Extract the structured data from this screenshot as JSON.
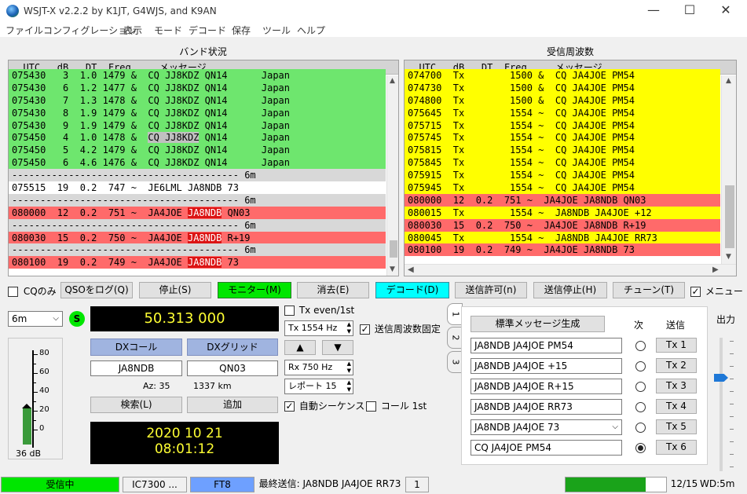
{
  "app": {
    "title": "WSJT-X   v2.2.2   by K1JT, G4WJS, and K9AN"
  },
  "menu": [
    "ファイル",
    "コンフィグレーション",
    "表示",
    "モード",
    "デコード",
    "保存",
    "ツール",
    "ヘルプ"
  ],
  "band_panel": {
    "title": "バンド状況",
    "header": "  UTC   dB   DT  Freq     メッセージ",
    "rows": [
      {
        "t": "075430   3  1.0 1479 &  CQ JJ8KDZ QN14      Japan",
        "c": "g"
      },
      {
        "t": "075430   6  1.2 1477 &  CQ JJ8KDZ QN14      Japan",
        "c": "g"
      },
      {
        "t": "075430   7  1.3 1478 &  CQ JJ8KDZ QN14      Japan",
        "c": "g"
      },
      {
        "t": "075430   8  1.9 1479 &  CQ JJ8KDZ QN14      Japan",
        "c": "g"
      },
      {
        "t": "075430   9  1.9 1479 &  CQ JJ8KDZ QN14      Japan",
        "c": "g"
      },
      {
        "t": "075450   4  1.0 1478 &  ",
        "c": "g",
        "h": "CQ JJ8KDZ",
        "hc": "gr",
        "a": " QN14      Japan"
      },
      {
        "t": "075450   5  4.2 1479 &  CQ JJ8KDZ QN14      Japan",
        "c": "g"
      },
      {
        "t": "075450   6  4.6 1476 &  CQ JJ8KDZ QN14      Japan",
        "c": "g"
      },
      {
        "t": "---------------------------------------- 6m",
        "c": "s"
      },
      {
        "t": "075515  19  0.2  747 ~  JE6LML JA8NDB 73",
        "c": "w"
      },
      {
        "t": "---------------------------------------- 6m",
        "c": "s"
      },
      {
        "t": "080000  12  0.2  751 ~  JA4JOE ",
        "c": "r",
        "h": "JA8NDB",
        "hc": "hl",
        "a": " QN03"
      },
      {
        "t": "---------------------------------------- 6m",
        "c": "s"
      },
      {
        "t": "080030  15  0.2  750 ~  JA4JOE ",
        "c": "r",
        "h": "JA8NDB",
        "hc": "hl",
        "a": " R+19"
      },
      {
        "t": "---------------------------------------- 6m",
        "c": "s"
      },
      {
        "t": "080100  19  0.2  749 ~  JA4JOE ",
        "c": "r",
        "h": "JA8NDB",
        "hc": "hl",
        "a": " 73"
      }
    ]
  },
  "rx_panel": {
    "title": "受信周波数",
    "header": "  UTC   dB   DT  Freq     メッセージ",
    "rows": [
      {
        "t": "074700  Tx        1500 &  CQ JA4JOE PM54",
        "c": "y"
      },
      {
        "t": "074730  Tx        1500 &  CQ JA4JOE PM54",
        "c": "y"
      },
      {
        "t": "074800  Tx        1500 &  CQ JA4JOE PM54",
        "c": "y"
      },
      {
        "t": "075645  Tx        1554 ~  CQ JA4JOE PM54",
        "c": "y"
      },
      {
        "t": "075715  Tx        1554 ~  CQ JA4JOE PM54",
        "c": "y"
      },
      {
        "t": "075745  Tx        1554 ~  CQ JA4JOE PM54",
        "c": "y"
      },
      {
        "t": "075815  Tx        1554 ~  CQ JA4JOE PM54",
        "c": "y"
      },
      {
        "t": "075845  Tx        1554 ~  CQ JA4JOE PM54",
        "c": "y"
      },
      {
        "t": "075915  Tx        1554 ~  CQ JA4JOE PM54",
        "c": "y"
      },
      {
        "t": "075945  Tx        1554 ~  CQ JA4JOE PM54",
        "c": "y"
      },
      {
        "t": "080000  12  0.2  751 ~  JA4JOE JA8NDB QN03",
        "c": "r"
      },
      {
        "t": "080015  Tx        1554 ~  JA8NDB JA4JOE +12",
        "c": "y"
      },
      {
        "t": "080030  15  0.2  750 ~  JA4JOE JA8NDB R+19",
        "c": "r"
      },
      {
        "t": "080045  Tx        1554 ~  JA8NDB JA4JOE RR73",
        "c": "y"
      },
      {
        "t": "080100  19  0.2  749 ~  JA4JOE JA8NDB 73",
        "c": "r"
      }
    ]
  },
  "controls": {
    "cq_only": "CQのみ",
    "log_qso": "QSOをログ(Q)",
    "stop": "停止(S)",
    "monitor": "モニター(M)",
    "erase": "消去(E)",
    "decode": "デコード(D)",
    "enable_tx": "送信許可(n)",
    "halt_tx": "送信停止(H)",
    "tune": "チューン(T)",
    "menus": "メニュー"
  },
  "left": {
    "band": "6m",
    "s_label": "S",
    "freq": "50.313 000",
    "dx_call_btn": "DXコール",
    "dx_grid_btn": "DXグリッド",
    "dx_call": "JA8NDB",
    "dx_grid": "QN03",
    "az": "Az: 35",
    "dist": "1337 km",
    "lookup": "検索(L)",
    "add": "追加",
    "date": "2020 10 21",
    "time": "08:01:12",
    "meter_db": "36 dB",
    "meter_ticks": [
      "80",
      "60",
      "40",
      "20",
      "0"
    ]
  },
  "mid": {
    "tx_even": "Tx even/1st",
    "tx_freq": "Tx  1554  Hz",
    "hold_tx": "送信周波数固定",
    "rx_freq": "Rx  750  Hz",
    "report": "レポート 15",
    "auto_seq": "自動シーケンス",
    "call_1st": "コール 1st",
    "up": "▲",
    "down": "▼"
  },
  "tabs": [
    "1",
    "2",
    "3"
  ],
  "msgs": {
    "gen": "標準メッセージ生成",
    "next": "次",
    "send": "送信",
    "items": [
      {
        "text": "JA8NDB JA4JOE PM54",
        "btn": "Tx 1",
        "sel": false,
        "dd": false
      },
      {
        "text": "JA8NDB JA4JOE +15",
        "btn": "Tx 2",
        "sel": false,
        "dd": false
      },
      {
        "text": "JA8NDB JA4JOE R+15",
        "btn": "Tx 3",
        "sel": false,
        "dd": false
      },
      {
        "text": "JA8NDB JA4JOE RR73",
        "btn": "Tx 4",
        "sel": false,
        "dd": false
      },
      {
        "text": "JA8NDB JA4JOE 73",
        "btn": "Tx 5",
        "sel": false,
        "dd": true
      },
      {
        "text": "CQ JA4JOE PM54",
        "btn": "Tx 6",
        "sel": true,
        "dd": false
      }
    ]
  },
  "power": {
    "label": "出力"
  },
  "status": {
    "receiving": "受信中",
    "rig": "IC7300 ...",
    "mode": "FT8",
    "last_tx": "最終送信: JA8NDB JA4JOE RR73",
    "count": "1",
    "progress_text": "12/15",
    "wd": "WD:5m",
    "progress": 0.8
  },
  "colors": {
    "green": "#00e600",
    "monitor": "#00e600",
    "decode": "#00ffff",
    "yellow": "#ffff00",
    "red": "#ff6a6a"
  }
}
